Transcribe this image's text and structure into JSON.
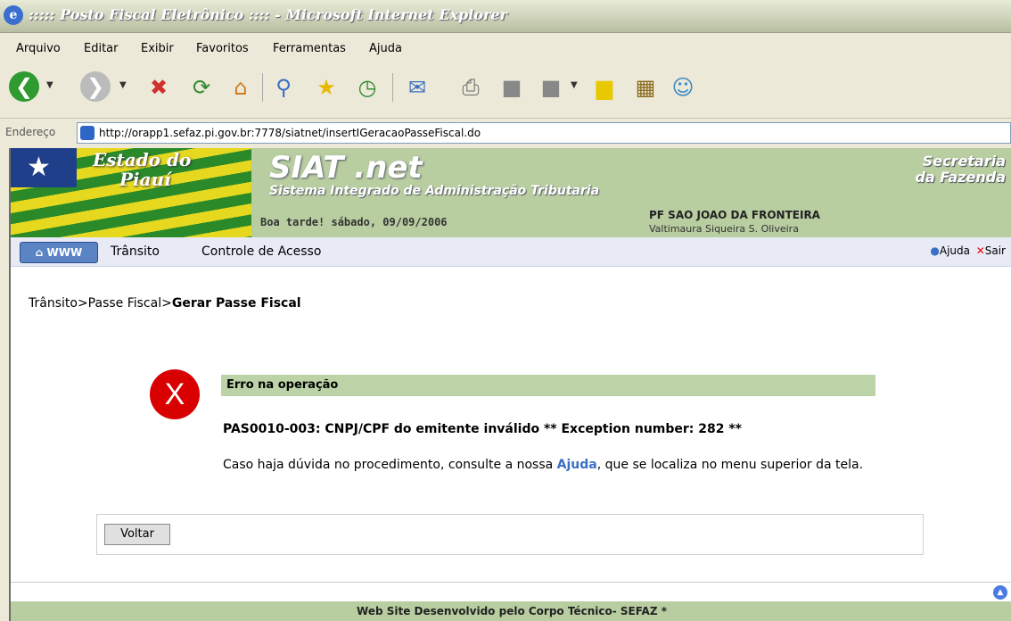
{
  "window": {
    "title": "::::: Posto Fiscal Eletrônico :::: - Microsoft Internet Explorer"
  },
  "menu": [
    "Arquivo",
    "Editar",
    "Exibir",
    "Favoritos",
    "Ferramentas",
    "Ajuda"
  ],
  "address": {
    "label": "Endereço",
    "url": "http://orapp1.sefaz.pi.gov.br:7778/siatnet/insertIGeracaoPasseFiscal.do"
  },
  "banner": {
    "state_line1": "Estado do",
    "state_line2": "Piauí",
    "system_title": "SIAT .net",
    "system_subtitle": "Sistema Integrado de Administração Tributaria",
    "secretaria_line1": "Secretaria",
    "secretaria_line2": "da Fazenda",
    "greeting": "Boa tarde! sábado, 09/09/2006",
    "post": "PF SAO JOAO DA FRONTEIRA",
    "user": "Valtimaura Siqueira S. Oliveira"
  },
  "nav": {
    "home": "WWW",
    "items": [
      "Trânsito",
      "Controle de Acesso"
    ],
    "help": "Ajuda",
    "exit": "Sair"
  },
  "breadcrumb": {
    "path": "Trânsito>Passe Fiscal>",
    "current": "Gerar Passe Fiscal"
  },
  "error": {
    "title": "Erro na operação",
    "message": "PAS0010-003: CNPJ/CPF do emitente inválido ** Exception number: 282 **",
    "help_before": "Caso haja dúvida no procedimento, consulte a nossa ",
    "help_link": "Ajuda",
    "help_after": ", que se localiza no menu superior da tela."
  },
  "buttons": {
    "back": "Voltar"
  },
  "footer": "Web Site Desenvolvido pelo Corpo Técnico- SEFAZ *"
}
